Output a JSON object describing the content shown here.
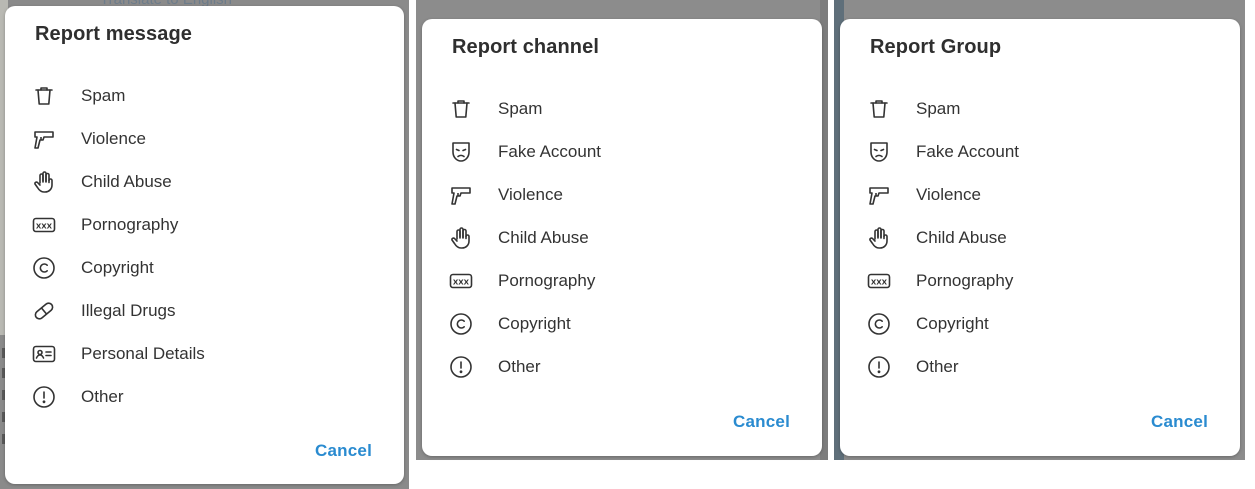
{
  "background": {
    "partial_text": "Translate to English"
  },
  "dialogs": [
    {
      "title": "Report message",
      "items": [
        {
          "label": "Spam",
          "icon": "trash-icon"
        },
        {
          "label": "Violence",
          "icon": "gun-icon"
        },
        {
          "label": "Child Abuse",
          "icon": "hand-icon"
        },
        {
          "label": "Pornography",
          "icon": "xxx-icon"
        },
        {
          "label": "Copyright",
          "icon": "copyright-icon"
        },
        {
          "label": "Illegal Drugs",
          "icon": "pill-icon"
        },
        {
          "label": "Personal Details",
          "icon": "id-card-icon"
        },
        {
          "label": "Other",
          "icon": "exclamation-icon"
        }
      ],
      "cancel_label": "Cancel"
    },
    {
      "title": "Report channel",
      "items": [
        {
          "label": "Spam",
          "icon": "trash-icon"
        },
        {
          "label": "Fake Account",
          "icon": "mask-icon"
        },
        {
          "label": "Violence",
          "icon": "gun-icon"
        },
        {
          "label": "Child Abuse",
          "icon": "hand-icon"
        },
        {
          "label": "Pornography",
          "icon": "xxx-icon"
        },
        {
          "label": "Copyright",
          "icon": "copyright-icon"
        },
        {
          "label": "Other",
          "icon": "exclamation-icon"
        }
      ],
      "cancel_label": "Cancel"
    },
    {
      "title": "Report Group",
      "items": [
        {
          "label": "Spam",
          "icon": "trash-icon"
        },
        {
          "label": "Fake Account",
          "icon": "mask-icon"
        },
        {
          "label": "Violence",
          "icon": "gun-icon"
        },
        {
          "label": "Child Abuse",
          "icon": "hand-icon"
        },
        {
          "label": "Pornography",
          "icon": "xxx-icon"
        },
        {
          "label": "Copyright",
          "icon": "copyright-icon"
        },
        {
          "label": "Other",
          "icon": "exclamation-icon"
        }
      ],
      "cancel_label": "Cancel"
    }
  ],
  "colors": {
    "accent": "#2a8bd0",
    "text": "#333333",
    "overlay": "#8a8a8a"
  }
}
